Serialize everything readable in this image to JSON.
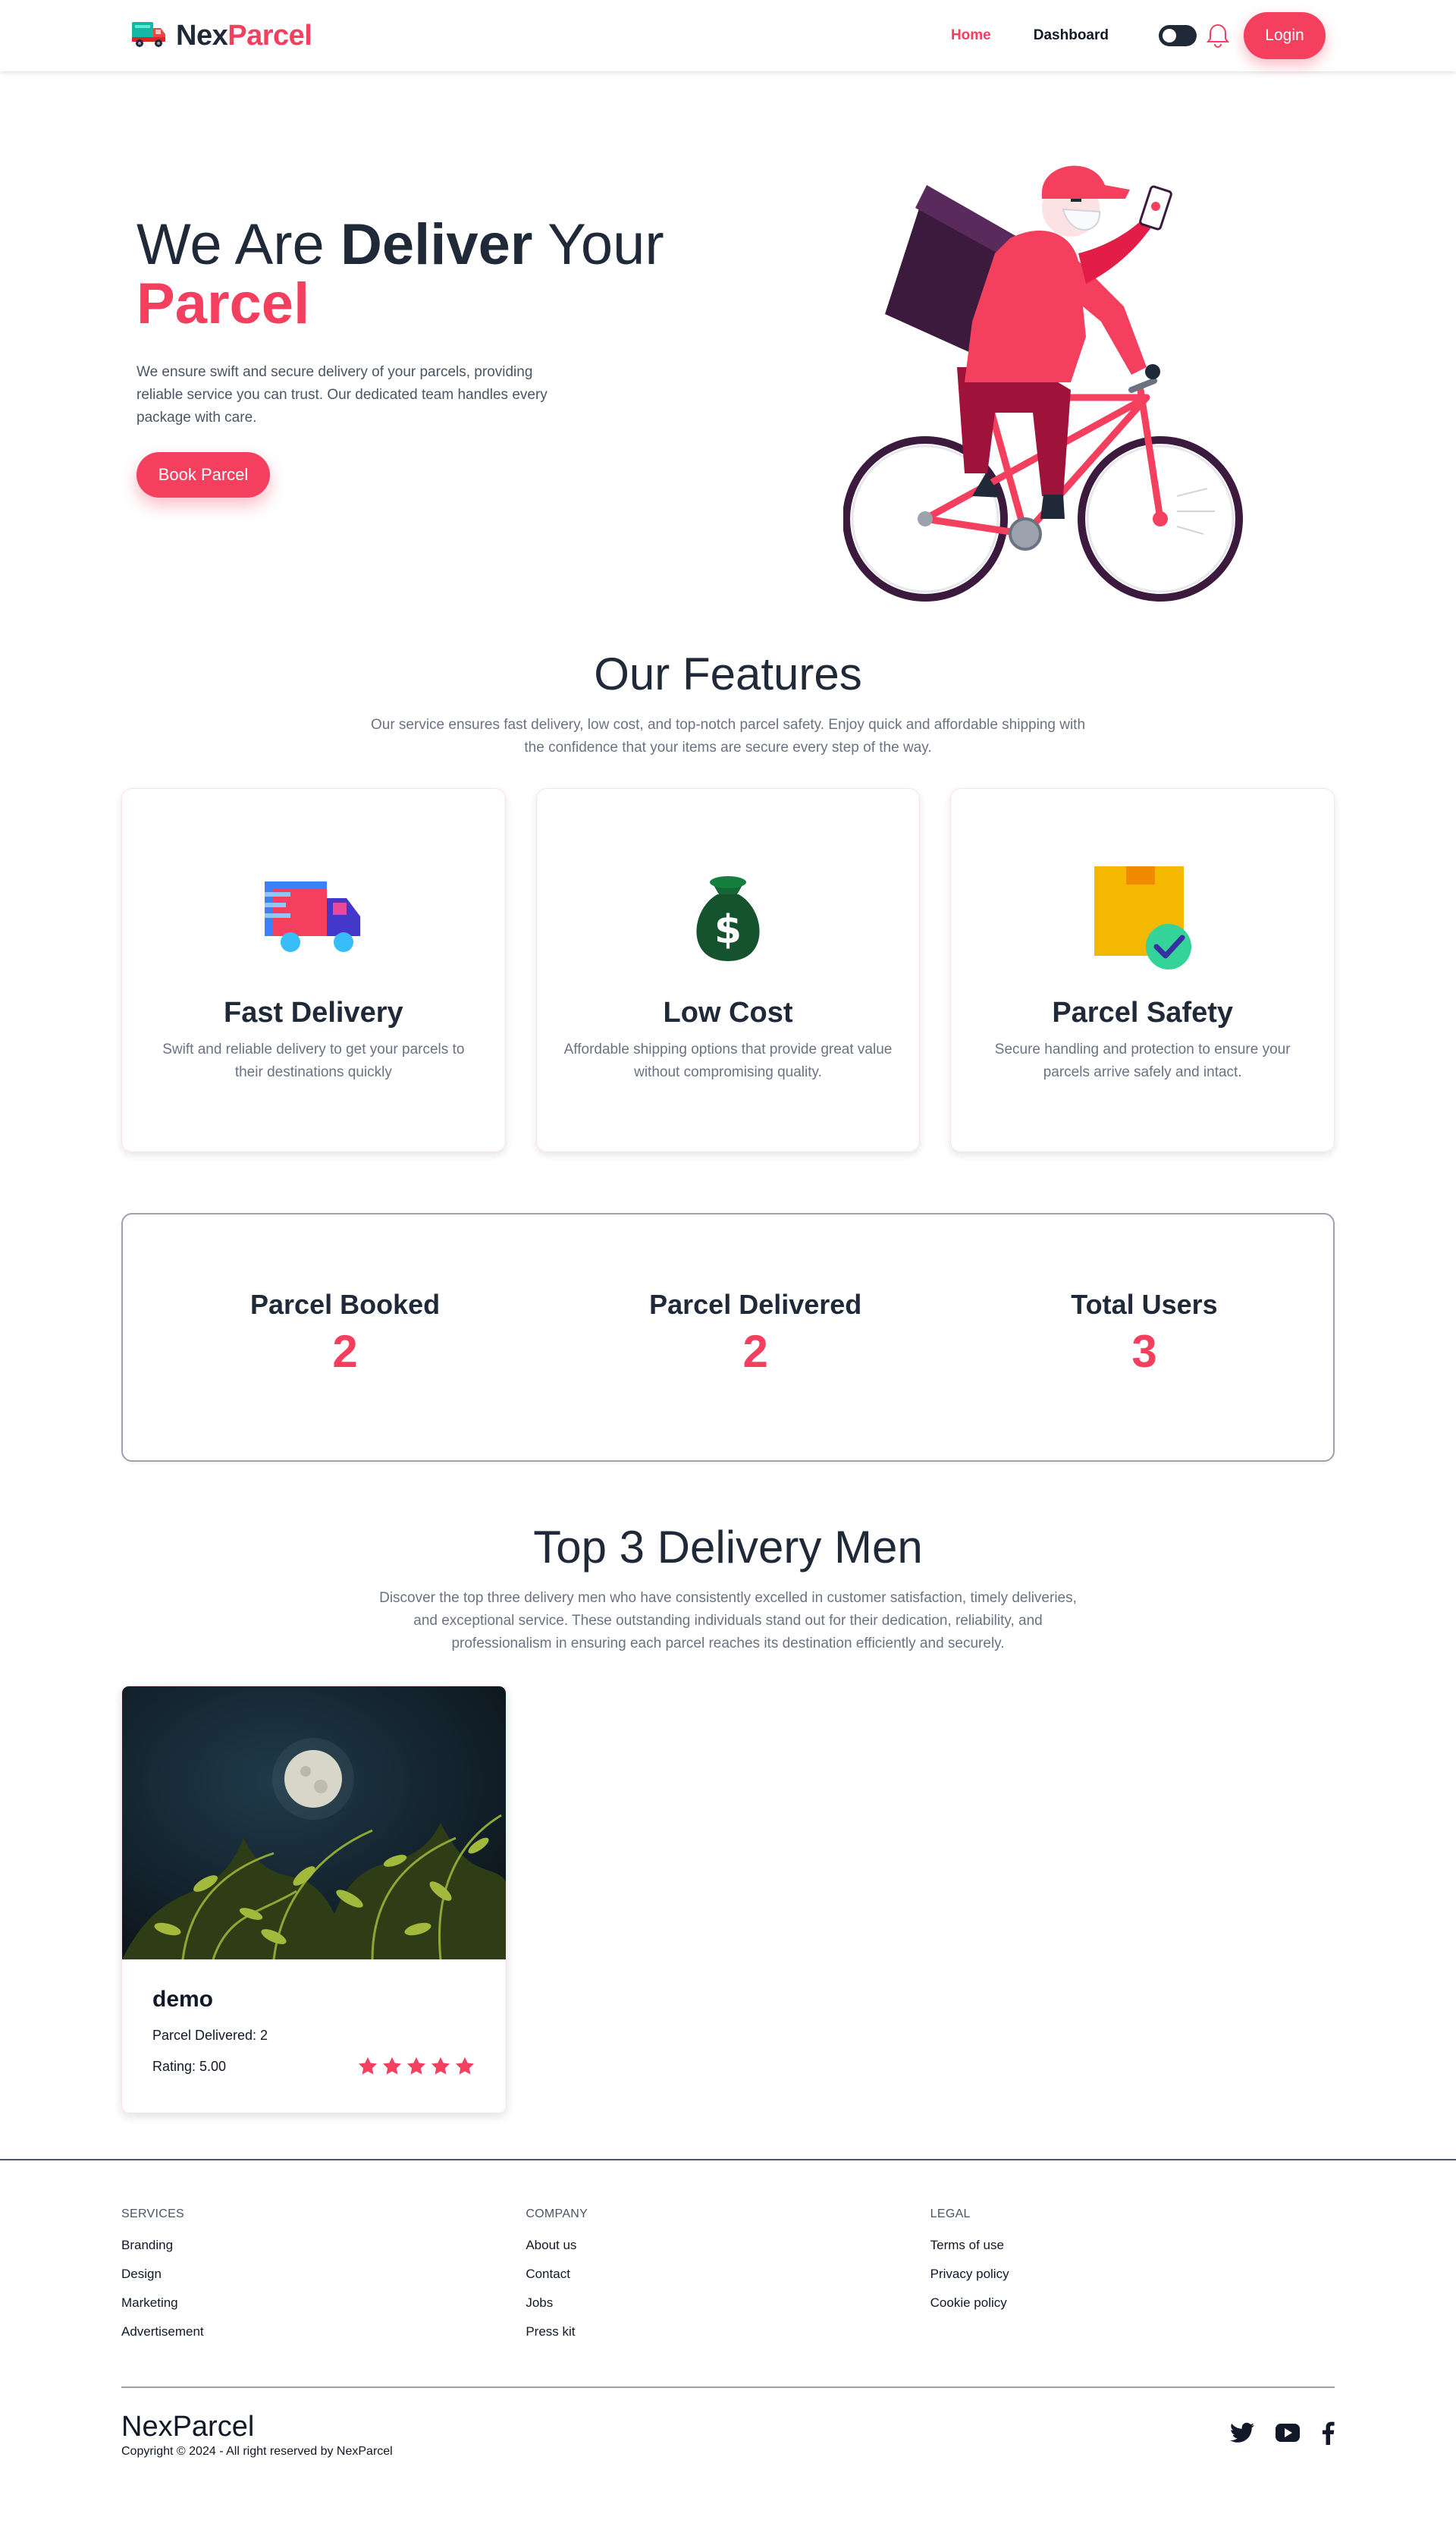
{
  "nav": {
    "brand_prefix": "Nex",
    "brand_suffix": "Parcel",
    "links": [
      "Home",
      "Dashboard"
    ],
    "login_label": "Login"
  },
  "hero": {
    "title_part1": "We Are ",
    "title_bold": "Deliver",
    "title_part2": " Your",
    "title_accent": "Parcel",
    "description": "We ensure swift and secure delivery of your parcels, providing reliable service you can trust. Our dedicated team handles every package with care.",
    "button_label": "Book Parcel"
  },
  "features": {
    "title": "Our Features",
    "subtitle": "Our service ensures fast delivery, low cost, and top-notch parcel safety. Enjoy quick and affordable shipping with the confidence that your items are secure every step of the way.",
    "cards": [
      {
        "icon": "delivery-truck-icon",
        "title": "Fast Delivery",
        "description": "Swift and reliable delivery to get your parcels to their destinations quickly"
      },
      {
        "icon": "money-bag-icon",
        "title": "Low Cost",
        "description": "Affordable shipping options that provide great value without compromising quality."
      },
      {
        "icon": "parcel-check-icon",
        "title": "Parcel Safety",
        "description": "Secure handling and protection to ensure your parcels arrive safely and intact."
      }
    ]
  },
  "stats": [
    {
      "label": "Parcel Booked",
      "value": "2"
    },
    {
      "label": "Parcel Delivered",
      "value": "2"
    },
    {
      "label": "Total Users",
      "value": "3"
    }
  ],
  "top_men": {
    "title": "Top 3 Delivery Men",
    "subtitle": "Discover the top three delivery men who have consistently excelled in customer satisfaction, timely deliveries, and exceptional service. These outstanding individuals stand out for their dedication, reliability, and professionalism in ensuring each parcel reaches its destination efficiently and securely.",
    "men": [
      {
        "name": "demo",
        "delivered": "Parcel Delivered: 2",
        "rating": "Rating: 5.00",
        "stars": 5
      }
    ]
  },
  "footer": {
    "columns": [
      {
        "title": "SERVICES",
        "links": [
          "Branding",
          "Design",
          "Marketing",
          "Advertisement"
        ]
      },
      {
        "title": "COMPANY",
        "links": [
          "About us",
          "Contact",
          "Jobs",
          "Press kit"
        ]
      },
      {
        "title": "LEGAL",
        "links": [
          "Terms of use",
          "Privacy policy",
          "Cookie policy"
        ]
      }
    ],
    "brand": "NexParcel",
    "copyright": "Copyright © 2024 - All right reserved by NexParcel",
    "socials": [
      "twitter-icon",
      "youtube-icon",
      "facebook-icon"
    ]
  },
  "colors": {
    "accent": "#f43f5e",
    "dark": "#1f2937",
    "muted": "#6b7280"
  }
}
